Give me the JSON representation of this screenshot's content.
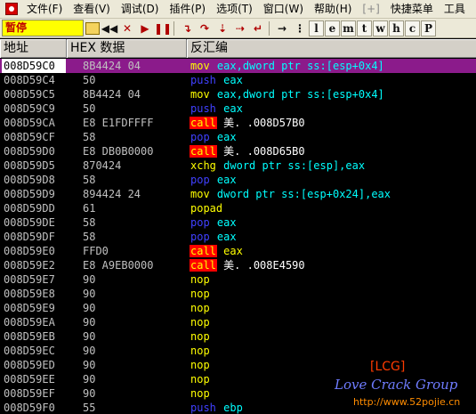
{
  "menu": [
    {
      "label": "文件(F)"
    },
    {
      "label": "查看(V)"
    },
    {
      "label": "调试(D)"
    },
    {
      "label": "插件(P)"
    },
    {
      "label": "选项(T)"
    },
    {
      "label": "窗口(W)"
    },
    {
      "label": "帮助(H)"
    },
    {
      "label": "[+]"
    },
    {
      "label": "快捷菜单"
    },
    {
      "label": "工具"
    }
  ],
  "toolbar": {
    "status": "暂停",
    "letters": [
      "l",
      "e",
      "m",
      "t",
      "w",
      "h",
      "c",
      "P"
    ]
  },
  "columns": {
    "address": "地址",
    "hex": "HEX 数据",
    "disasm": "反汇编"
  },
  "rows": [
    {
      "addr": "008D59C0",
      "hex": "8B4424 04",
      "mnemonic": "mov",
      "operands": "eax,dword ptr ss:[esp+0x4]",
      "type": "mov",
      "selected": true
    },
    {
      "addr": "008D59C4",
      "hex": "50",
      "mnemonic": "push",
      "operands": "eax",
      "type": "push"
    },
    {
      "addr": "008D59C5",
      "hex": "8B4424 04",
      "mnemonic": "mov",
      "operands": "eax,dword ptr ss:[esp+0x4]",
      "type": "mov"
    },
    {
      "addr": "008D59C9",
      "hex": "50",
      "mnemonic": "push",
      "operands": "eax",
      "type": "push"
    },
    {
      "addr": "008D59CA",
      "hex": "E8 E1FDFFFF",
      "mnemonic": "call",
      "operands": "美.   .008D57B0",
      "type": "call"
    },
    {
      "addr": "008D59CF",
      "hex": "58",
      "mnemonic": "pop",
      "operands": "eax",
      "type": "pop"
    },
    {
      "addr": "008D59D0",
      "hex": "E8 DB0B0000",
      "mnemonic": "call",
      "operands": "美.   .008D65B0",
      "type": "call"
    },
    {
      "addr": "008D59D5",
      "hex": "870424",
      "mnemonic": "xchg",
      "operands": "dword ptr ss:[esp],eax",
      "type": "xchg"
    },
    {
      "addr": "008D59D8",
      "hex": "58",
      "mnemonic": "pop",
      "operands": "eax",
      "type": "pop"
    },
    {
      "addr": "008D59D9",
      "hex": "894424 24",
      "mnemonic": "mov",
      "operands": "dword ptr ss:[esp+0x24],eax",
      "type": "mov"
    },
    {
      "addr": "008D59DD",
      "hex": "61",
      "mnemonic": "popad",
      "operands": "",
      "type": "popad"
    },
    {
      "addr": "008D59DE",
      "hex": "58",
      "mnemonic": "pop",
      "operands": "eax",
      "type": "pop"
    },
    {
      "addr": "008D59DF",
      "hex": "58",
      "mnemonic": "pop",
      "operands": "eax",
      "type": "pop"
    },
    {
      "addr": "008D59E0",
      "hex": "FFD0",
      "mnemonic": "call",
      "operands": "eax",
      "type": "call-reg"
    },
    {
      "addr": "008D59E2",
      "hex": "E8 A9EB0000",
      "mnemonic": "call",
      "operands": "美.   .008E4590",
      "type": "call"
    },
    {
      "addr": "008D59E7",
      "hex": "90",
      "mnemonic": "nop",
      "operands": "",
      "type": "nop"
    },
    {
      "addr": "008D59E8",
      "hex": "90",
      "mnemonic": "nop",
      "operands": "",
      "type": "nop"
    },
    {
      "addr": "008D59E9",
      "hex": "90",
      "mnemonic": "nop",
      "operands": "",
      "type": "nop"
    },
    {
      "addr": "008D59EA",
      "hex": "90",
      "mnemonic": "nop",
      "operands": "",
      "type": "nop"
    },
    {
      "addr": "008D59EB",
      "hex": "90",
      "mnemonic": "nop",
      "operands": "",
      "type": "nop"
    },
    {
      "addr": "008D59EC",
      "hex": "90",
      "mnemonic": "nop",
      "operands": "",
      "type": "nop"
    },
    {
      "addr": "008D59ED",
      "hex": "90",
      "mnemonic": "nop",
      "operands": "",
      "type": "nop"
    },
    {
      "addr": "008D59EE",
      "hex": "90",
      "mnemonic": "nop",
      "operands": "",
      "type": "nop"
    },
    {
      "addr": "008D59EF",
      "hex": "90",
      "mnemonic": "nop",
      "operands": "",
      "type": "nop"
    },
    {
      "addr": "008D59F0",
      "hex": "55",
      "mnemonic": "push",
      "operands": "ebp",
      "type": "push"
    }
  ],
  "watermark": {
    "tag": "[LCG]",
    "group": "Love Crack Group",
    "url": "http://www.52pojie.cn"
  },
  "colors": {
    "selection": "#8b1b8b",
    "call_bg": "#ff0000",
    "call_fg": "#ffff00",
    "push_pop": "#4040ff",
    "operand": "#00ffff",
    "status_bg": "#ffff00"
  }
}
